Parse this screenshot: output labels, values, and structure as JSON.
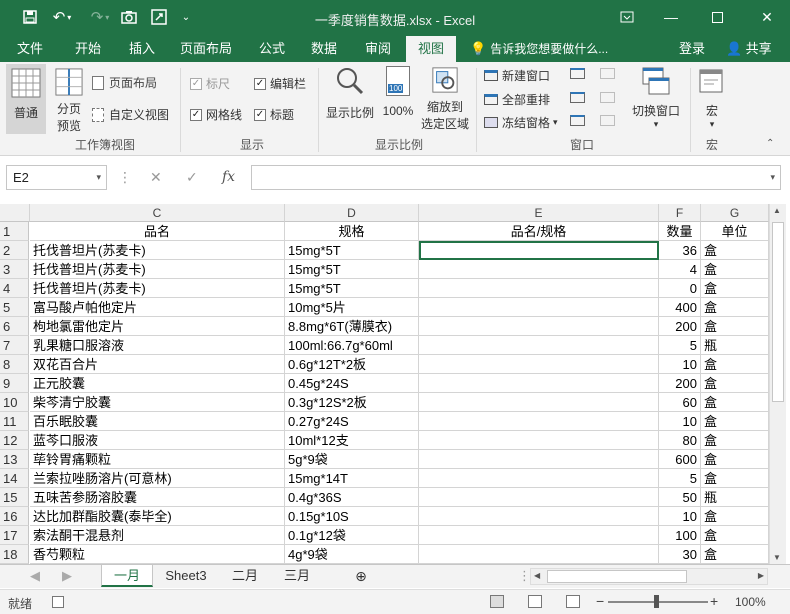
{
  "window": {
    "title": "一季度销售数据.xlsx - Excel"
  },
  "menu": {
    "tabs": [
      "文件",
      "开始",
      "插入",
      "页面布局",
      "公式",
      "数据",
      "审阅",
      "视图"
    ],
    "active_tab": "视图",
    "tell_me": "告诉我您想要做什么...",
    "login": "登录",
    "share": "共享"
  },
  "ribbon": {
    "workbook_views": {
      "label": "工作簿视图",
      "normal": "普通",
      "page_break_line1": "分页",
      "page_break_line2": "预览",
      "page_layout": "页面布局",
      "custom_views": "自定义视图"
    },
    "show": {
      "label": "显示",
      "ruler": "标尺",
      "formula_bar": "编辑栏",
      "gridlines": "网格线",
      "headings": "标题"
    },
    "zoom": {
      "label": "显示比例",
      "zoom": "显示比例",
      "zoom100": "100%",
      "zoom_sel_line1": "缩放到",
      "zoom_sel_line2": "选定区域",
      "icon100": "100"
    },
    "window": {
      "label": "窗口",
      "new_window": "新建窗口",
      "arrange_all": "全部重排",
      "freeze_panes": "冻结窗格",
      "switch_windows": "切换窗口"
    },
    "macros": {
      "label": "宏",
      "macros": "宏"
    }
  },
  "formula_bar": {
    "name_box": "E2",
    "fx": "fx",
    "cancel": "✕",
    "enter": "✓",
    "value": ""
  },
  "columns": [
    "C",
    "D",
    "E",
    "F",
    "G"
  ],
  "rows": [
    {
      "n": "1",
      "c": "品名",
      "d": "规格",
      "e": "品名/规格",
      "f": "数量",
      "g": "单位"
    },
    {
      "n": "2",
      "c": "托伐普坦片(苏麦卡)",
      "d": "15mg*5T",
      "e": "",
      "f": "36",
      "g": "盒"
    },
    {
      "n": "3",
      "c": "托伐普坦片(苏麦卡)",
      "d": "15mg*5T",
      "e": "",
      "f": "4",
      "g": "盒"
    },
    {
      "n": "4",
      "c": "托伐普坦片(苏麦卡)",
      "d": "15mg*5T",
      "e": "",
      "f": "0",
      "g": "盒"
    },
    {
      "n": "5",
      "c": "富马酸卢帕他定片",
      "d": "10mg*5片",
      "e": "",
      "f": "400",
      "g": "盒"
    },
    {
      "n": "6",
      "c": "枸地氯雷他定片",
      "d": "8.8mg*6T(薄膜衣)",
      "e": "",
      "f": "200",
      "g": "盒"
    },
    {
      "n": "7",
      "c": "乳果糖口服溶液",
      "d": "100ml:66.7g*60ml",
      "e": "",
      "f": "5",
      "g": "瓶"
    },
    {
      "n": "8",
      "c": "双花百合片",
      "d": "0.6g*12T*2板",
      "e": "",
      "f": "10",
      "g": "盒"
    },
    {
      "n": "9",
      "c": "正元胶囊",
      "d": "0.45g*24S",
      "e": "",
      "f": "200",
      "g": "盒"
    },
    {
      "n": "10",
      "c": "柴芩清宁胶囊",
      "d": "0.3g*12S*2板",
      "e": "",
      "f": "60",
      "g": "盒"
    },
    {
      "n": "11",
      "c": "百乐眠胶囊",
      "d": "0.27g*24S",
      "e": "",
      "f": "10",
      "g": "盒"
    },
    {
      "n": "12",
      "c": "蓝芩口服液",
      "d": "10ml*12支",
      "e": "",
      "f": "80",
      "g": "盒"
    },
    {
      "n": "13",
      "c": "荜铃胃痛颗粒",
      "d": "5g*9袋",
      "e": "",
      "f": "600",
      "g": "盒"
    },
    {
      "n": "14",
      "c": "兰索拉唑肠溶片(可意林)",
      "d": "15mg*14T",
      "e": "",
      "f": "5",
      "g": "盒"
    },
    {
      "n": "15",
      "c": "五味苦参肠溶胶囊",
      "d": "0.4g*36S",
      "e": "",
      "f": "50",
      "g": "瓶"
    },
    {
      "n": "16",
      "c": "达比加群酯胶囊(泰毕全)",
      "d": "0.15g*10S",
      "e": "",
      "f": "10",
      "g": "盒"
    },
    {
      "n": "17",
      "c": "索法酮干混悬剂",
      "d": "0.1g*12袋",
      "e": "",
      "f": "100",
      "g": "盒"
    },
    {
      "n": "18",
      "c": "香芍颗粒",
      "d": "4g*9袋",
      "e": "",
      "f": "30",
      "g": "盒"
    }
  ],
  "sheets": [
    "一月",
    "Sheet3",
    "二月",
    "三月"
  ],
  "active_sheet": "一月",
  "status": {
    "ready": "就绪",
    "zoom": "100%"
  },
  "colors": {
    "accent": "#217346"
  }
}
